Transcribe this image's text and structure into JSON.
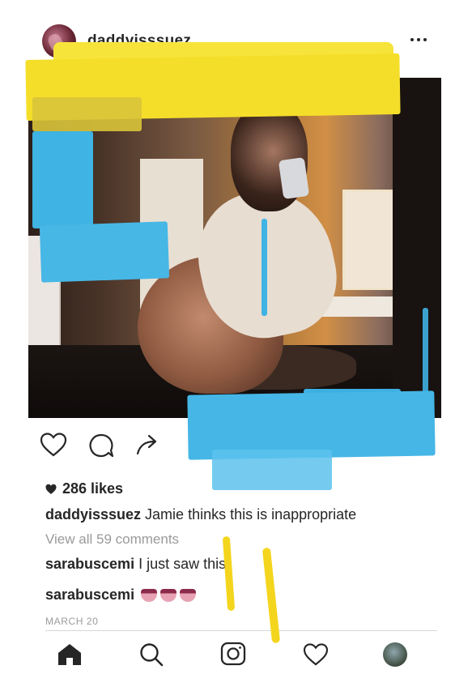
{
  "post": {
    "username": "daddyisssuez",
    "more_icon": "more-horizontal-icon",
    "likes": "286 likes",
    "caption_user": "daddyisssuez",
    "caption_text": " Jamie thinks this is inappropriate",
    "view_all_comments": "View all 59 comments",
    "comments": [
      {
        "user": "sarabuscemi",
        "text": " I just saw this"
      },
      {
        "user": "sarabuscemi",
        "text": "",
        "emoji": "mouth-icon x3"
      }
    ],
    "date": "MARCH 20"
  },
  "actions": {
    "like_icon": "heart-outline-icon",
    "comment_icon": "comment-bubble-icon",
    "share_icon": "share-arrow-icon"
  },
  "bottom_nav": [
    "home-icon",
    "search-icon",
    "camera-icon",
    "heart-icon",
    "profile-avatar"
  ],
  "colors": {
    "paint_yellow": "#f5de2a",
    "paint_blue": "#45b6e6",
    "text": "#262626",
    "muted": "#9a9a9a"
  }
}
